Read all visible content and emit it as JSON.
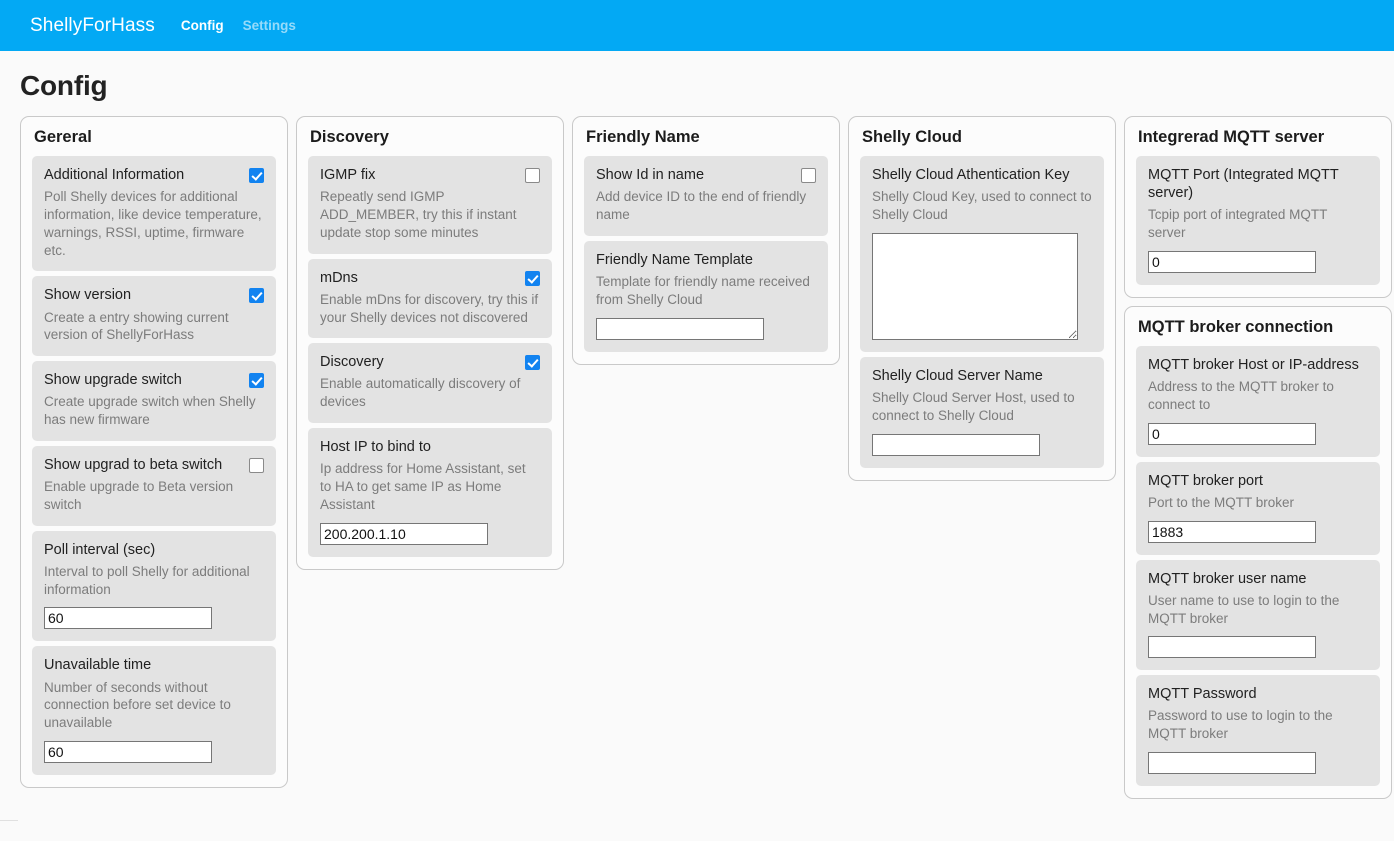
{
  "navbar": {
    "brand": "ShellyForHass",
    "links": [
      {
        "label": "Config",
        "active": true
      },
      {
        "label": "Settings",
        "active": false
      }
    ]
  },
  "page": {
    "title": "Config",
    "accent_color": "#03a9f4",
    "checkbox_checked_color": "#1283f0",
    "card_background": "#e3e3e3",
    "panel_background": "#fcfcfc",
    "page_background": "#fafafa"
  },
  "columns": [
    {
      "panels": [
        {
          "title": "Gereral",
          "cards": [
            {
              "label": "Additional Information",
              "desc": "Poll Shelly devices for additional information, like device temperature, warnings, RSSI, uptime, firmware etc.",
              "control": "checkbox",
              "checked": true
            },
            {
              "label": "Show version",
              "desc": "Create a entry showing current version of ShellyForHass",
              "control": "checkbox",
              "checked": true
            },
            {
              "label": "Show upgrade switch",
              "desc": "Create upgrade switch when Shelly has new firmware",
              "control": "checkbox",
              "checked": true
            },
            {
              "label": "Show upgrad to beta switch",
              "desc": "Enable upgrade to Beta version switch",
              "control": "checkbox",
              "checked": false
            },
            {
              "label": "Poll interval (sec)",
              "desc": "Interval to poll Shelly for additional information",
              "control": "text",
              "value": "60",
              "placeholder": ""
            },
            {
              "label": "Unavailable time",
              "desc": "Number of seconds without connection before set device to unavailable",
              "control": "text",
              "value": "60",
              "placeholder": ""
            }
          ]
        }
      ]
    },
    {
      "panels": [
        {
          "title": "Discovery",
          "cards": [
            {
              "label": "IGMP fix",
              "desc": "Repeatly send IGMP ADD_MEMBER, try this if instant update stop some minutes",
              "control": "checkbox",
              "checked": false
            },
            {
              "label": "mDns",
              "desc": "Enable mDns for discovery, try this if your Shelly devices not discovered",
              "control": "checkbox",
              "checked": true
            },
            {
              "label": "Discovery",
              "desc": "Enable automatically discovery of devices",
              "control": "checkbox",
              "checked": true
            },
            {
              "label": "Host IP to bind to",
              "desc": "Ip address for Home Assistant, set to HA to get same IP as Home Assistant",
              "control": "text",
              "value": "200.200.1.10",
              "placeholder": ""
            }
          ]
        }
      ]
    },
    {
      "panels": [
        {
          "title": "Friendly Name",
          "cards": [
            {
              "label": "Show Id in name",
              "desc": "Add device ID to the end of friendly name",
              "control": "checkbox",
              "checked": false
            },
            {
              "label": "Friendly Name Template",
              "desc": "Template for friendly name received from Shelly Cloud",
              "control": "text",
              "value": "",
              "placeholder": ""
            }
          ]
        }
      ]
    },
    {
      "panels": [
        {
          "title": "Shelly Cloud",
          "cards": [
            {
              "label": "Shelly Cloud Athentication Key",
              "desc": "Shelly Cloud Key, used to connect to Shelly Cloud",
              "control": "textarea",
              "value": "",
              "placeholder": ""
            },
            {
              "label": "Shelly Cloud Server Name",
              "desc": "Shelly Cloud Server Host, used to connect to Shelly Cloud",
              "control": "text",
              "value": "",
              "placeholder": ""
            }
          ]
        }
      ]
    },
    {
      "panels": [
        {
          "title": "Integrerad MQTT server",
          "cards": [
            {
              "label": "MQTT Port (Integrated MQTT server)",
              "desc": "Tcpip port of integrated MQTT server",
              "control": "text",
              "value": "0",
              "placeholder": ""
            }
          ]
        },
        {
          "title": "MQTT broker connection",
          "cards": [
            {
              "label": "MQTT broker Host or IP-address",
              "desc": "Address to the MQTT broker to connect to",
              "control": "text",
              "value": "0",
              "placeholder": ""
            },
            {
              "label": "MQTT broker port",
              "desc": "Port to the MQTT broker",
              "control": "text",
              "value": "1883",
              "placeholder": ""
            },
            {
              "label": "MQTT broker user name",
              "desc": "User name to use to login to the MQTT broker",
              "control": "text",
              "value": "",
              "placeholder": ""
            },
            {
              "label": "MQTT Password",
              "desc": "Password to use to login to the MQTT broker",
              "control": "text",
              "value": "",
              "placeholder": ""
            }
          ]
        }
      ]
    }
  ]
}
